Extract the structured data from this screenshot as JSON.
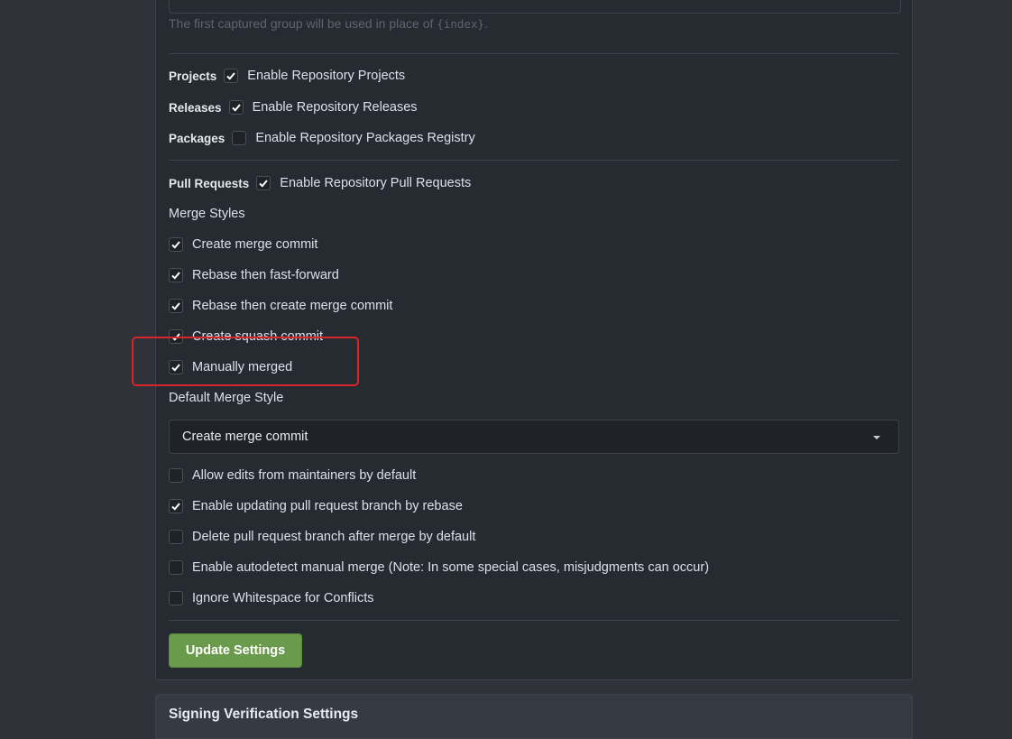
{
  "help_text": {
    "prefix": "The first captured group will be used in place of ",
    "code": "{index}",
    "suffix": "."
  },
  "units": {
    "projects": {
      "label": "Projects",
      "checkbox": "Enable Repository Projects",
      "checked": true
    },
    "releases": {
      "label": "Releases",
      "checkbox": "Enable Repository Releases",
      "checked": true
    },
    "packages": {
      "label": "Packages",
      "checkbox": "Enable Repository Packages Registry",
      "checked": false
    },
    "pulls": {
      "label": "Pull Requests",
      "checkbox": "Enable Repository Pull Requests",
      "checked": true
    }
  },
  "merge_styles": {
    "title": "Merge Styles",
    "items": [
      {
        "label": "Create merge commit",
        "checked": true
      },
      {
        "label": "Rebase then fast-forward",
        "checked": true
      },
      {
        "label": "Rebase then create merge commit",
        "checked": true
      },
      {
        "label": "Create squash commit",
        "checked": true
      },
      {
        "label": "Manually merged",
        "checked": true
      }
    ]
  },
  "default_merge_style": {
    "title": "Default Merge Style",
    "selected": "Create merge commit"
  },
  "options": [
    {
      "label": "Allow edits from maintainers by default",
      "checked": false
    },
    {
      "label": "Enable updating pull request branch by rebase",
      "checked": true
    },
    {
      "label": "Delete pull request branch after merge by default",
      "checked": false
    },
    {
      "label": "Enable autodetect manual merge (Note: In some special cases, misjudgments can occur)",
      "checked": false
    },
    {
      "label": "Ignore Whitespace for Conflicts",
      "checked": false
    }
  ],
  "update_button": "Update Settings",
  "next_section_title": "Signing Verification Settings",
  "colors": {
    "accent_button": "#6a9a4c",
    "highlight_box": "#d6252b",
    "panel_bg": "#262a31",
    "page_bg": "#2f3238"
  }
}
